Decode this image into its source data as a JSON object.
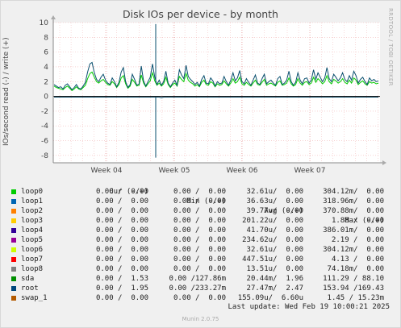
{
  "chart_data": {
    "type": "line",
    "title": "Disk IOs per device - by month",
    "ylabel": "IOs/second read (-) / write (+)",
    "ylim": [
      -9,
      10
    ],
    "yticks": [
      -8,
      -6,
      -4,
      -2,
      0,
      2,
      4,
      6,
      8,
      10
    ],
    "xlabels": [
      "Week 04",
      "Week 05",
      "Week 06",
      "Week 07"
    ],
    "series": [
      {
        "name": "sda",
        "color": "#00cc00",
        "values": [
          1.4,
          1.2,
          1.1,
          1.0,
          0.9,
          1.2,
          1.4,
          1.1,
          0.8,
          1.0,
          1.3,
          1.0,
          0.9,
          1.2,
          1.5,
          2.4,
          3.1,
          3.3,
          2.6,
          2.0,
          1.8,
          2.1,
          2.3,
          1.9,
          1.6,
          1.5,
          2.0,
          1.7,
          1.2,
          1.6,
          2.5,
          2.8,
          1.7,
          1.1,
          1.4,
          2.3,
          1.9,
          1.4,
          1.5,
          2.9,
          1.8,
          1.3,
          1.7,
          2.1,
          3.2,
          2.1,
          1.5,
          1.8,
          1.4,
          1.7,
          2.6,
          1.6,
          1.2,
          1.6,
          1.8,
          1.4,
          2.7,
          2.3,
          2.0,
          3.1,
          2.2,
          1.9,
          1.7,
          1.4,
          1.6,
          1.3,
          1.9,
          2.2,
          1.6,
          1.5,
          2.0,
          1.8,
          1.3,
          1.7,
          1.5,
          1.6,
          2.1,
          1.7,
          1.4,
          1.8,
          2.4,
          1.8,
          2.0,
          2.6,
          1.7,
          1.5,
          1.9,
          1.6,
          1.4,
          1.8,
          2.2,
          1.6,
          1.5,
          1.9,
          2.3,
          1.5,
          1.7,
          1.8,
          1.6,
          1.4,
          1.9,
          2.1,
          1.5,
          1.6,
          1.8,
          2.5,
          1.7,
          1.4,
          1.6,
          2.4,
          1.8,
          1.5,
          1.9,
          2.0,
          1.6,
          1.8,
          2.6,
          1.9,
          2.4,
          2.1,
          1.7,
          2.0,
          2.8,
          2.0,
          1.7,
          2.3,
          2.1,
          1.8,
          2.0,
          2.4,
          1.9,
          1.7,
          2.2,
          1.8,
          2.5,
          2.2,
          1.6,
          1.9,
          2.1,
          1.7,
          1.5,
          2.0,
          1.8,
          1.9,
          1.7,
          1.8
        ]
      },
      {
        "name": "root",
        "color": "#0a4f6e",
        "values": [
          1.6,
          1.4,
          1.2,
          1.3,
          1.0,
          1.5,
          1.7,
          1.3,
          0.9,
          1.2,
          1.6,
          1.1,
          1.0,
          1.4,
          1.9,
          3.3,
          4.4,
          4.6,
          3.2,
          2.3,
          2.0,
          2.6,
          3.0,
          2.2,
          1.8,
          1.6,
          2.5,
          2.0,
          1.3,
          1.9,
          3.3,
          3.9,
          2.0,
          1.2,
          1.6,
          3.0,
          2.3,
          1.5,
          1.7,
          4.1,
          2.1,
          1.4,
          2.0,
          2.6,
          4.4,
          2.6,
          1.6,
          2.2,
          1.5,
          2.0,
          3.4,
          1.8,
          1.3,
          1.8,
          2.2,
          1.5,
          3.6,
          2.9,
          2.4,
          4.2,
          2.7,
          2.3,
          2.0,
          1.6,
          1.9,
          1.4,
          2.3,
          2.8,
          1.8,
          1.7,
          2.5,
          2.1,
          1.4,
          2.0,
          1.7,
          1.8,
          2.7,
          2.0,
          1.5,
          2.2,
          3.2,
          2.1,
          2.5,
          3.5,
          2.0,
          1.7,
          2.4,
          1.9,
          1.5,
          2.2,
          2.9,
          1.8,
          1.6,
          2.4,
          3.0,
          1.7,
          2.0,
          2.2,
          1.8,
          1.5,
          2.4,
          2.7,
          1.6,
          1.8,
          2.2,
          3.4,
          2.0,
          1.5,
          1.9,
          3.2,
          2.2,
          1.7,
          2.4,
          2.5,
          1.8,
          2.2,
          3.6,
          2.3,
          3.2,
          2.6,
          2.0,
          2.5,
          3.9,
          2.4,
          2.0,
          3.0,
          2.6,
          2.1,
          2.5,
          3.2,
          2.3,
          2.0,
          2.8,
          2.2,
          3.4,
          2.8,
          1.8,
          2.3,
          2.6,
          2.0,
          1.6,
          2.5,
          2.1,
          2.3,
          2.0,
          2.1
        ]
      },
      {
        "name": "root read",
        "color": "#0a4f6e",
        "values": [
          -0.1,
          -0.1,
          -0.1,
          -0.1,
          -0.1,
          -0.1,
          -0.1,
          -0.1,
          -0.1,
          -0.1,
          -0.1,
          -0.1,
          -0.1,
          -0.1,
          -0.1,
          -0.1,
          -0.1,
          -0.1,
          -0.1,
          -0.1,
          -0.1,
          -0.1,
          -0.1,
          -0.1,
          -0.1,
          -0.1,
          -0.1,
          -0.1,
          -0.1,
          -0.1,
          -0.1,
          -0.1,
          -0.1,
          -0.1,
          -0.1,
          -0.1,
          -0.1,
          -0.1,
          -0.1,
          -0.1,
          -0.1,
          -0.1,
          -0.1,
          -0.1,
          -0.1,
          -0.1,
          -0.1,
          -0.1,
          -0.2,
          -0.1,
          -0.1,
          -0.1,
          -0.1,
          -0.1,
          -0.1,
          -0.1,
          -0.1,
          -0.1,
          -0.1,
          -0.1,
          -0.1,
          -0.1,
          -0.1,
          -0.1,
          -0.1,
          -0.1,
          -0.1,
          -0.1,
          -0.1,
          -0.1,
          -0.1,
          -0.1,
          -0.1,
          -0.1,
          -0.1,
          -0.1,
          -0.1,
          -0.1,
          -0.1,
          -0.1,
          -0.1,
          -0.1,
          -0.1,
          -0.1,
          -0.1,
          -0.1,
          -0.1,
          -0.1,
          -0.1,
          -0.1,
          -0.1,
          -0.1,
          -0.1,
          -0.1,
          -0.1,
          -0.1,
          -0.1,
          -0.1,
          -0.1,
          -0.1,
          -0.1,
          -0.1,
          -0.1,
          -0.1,
          -0.1,
          -0.1,
          -0.1,
          -0.1,
          -0.1,
          -0.1,
          -0.1,
          -0.1,
          -0.1,
          -0.1,
          -0.1,
          -0.1,
          -0.1,
          -0.1,
          -0.1,
          -0.1,
          -0.1,
          -0.1,
          -0.1,
          -0.1,
          -0.1,
          -0.1,
          -0.1,
          -0.1,
          -0.1,
          -0.1,
          -0.1,
          -0.1,
          -0.1,
          -0.1,
          -0.1,
          -0.1,
          -0.1,
          -0.1,
          -0.1,
          -0.1,
          -0.1,
          -0.1,
          -0.1,
          -0.1,
          -0.1,
          -0.1
        ]
      }
    ],
    "spike": {
      "up": 9.8,
      "down": -8.3
    },
    "grid": true
  },
  "title": "Disk IOs per device - by month",
  "ylabel": "IOs/second read (-) / write (+)",
  "watermark": "RRDTOOL / TOBI OETIKER",
  "legend_header": {
    "cur": "Cur (-/+)",
    "min": "Min (-/+)",
    "avg": "Avg (-/+)",
    "max": "Max (-/+)"
  },
  "legend": [
    {
      "name": "loop0",
      "color": "#00cc00",
      "cur": "0.00 /  0.00",
      "min": "0.00 /  0.00",
      "avg": "32.61u/  0.00",
      "max": "304.12m/  0.00"
    },
    {
      "name": "loop1",
      "color": "#0066b3",
      "cur": "0.00 /  0.00",
      "min": "0.00 /  0.00",
      "avg": "36.63u/  0.00",
      "max": "318.96m/  0.00"
    },
    {
      "name": "loop2",
      "color": "#ff8000",
      "cur": "0.00 /  0.00",
      "min": "0.00 /  0.00",
      "avg": "39.77u/  0.00",
      "max": "370.88m/  0.00"
    },
    {
      "name": "loop3",
      "color": "#ffcc00",
      "cur": "0.00 /  0.00",
      "min": "0.00 /  0.00",
      "avg": "201.22u/  0.00",
      "max": "1.88 /  0.00"
    },
    {
      "name": "loop4",
      "color": "#330099",
      "cur": "0.00 /  0.00",
      "min": "0.00 /  0.00",
      "avg": "41.70u/  0.00",
      "max": "386.01m/  0.00"
    },
    {
      "name": "loop5",
      "color": "#990099",
      "cur": "0.00 /  0.00",
      "min": "0.00 /  0.00",
      "avg": "234.62u/  0.00",
      "max": "2.19 /  0.00"
    },
    {
      "name": "loop6",
      "color": "#ccff00",
      "cur": "0.00 /  0.00",
      "min": "0.00 /  0.00",
      "avg": "32.61u/  0.00",
      "max": "304.12m/  0.00"
    },
    {
      "name": "loop7",
      "color": "#ff0000",
      "cur": "0.00 /  0.00",
      "min": "0.00 /  0.00",
      "avg": "447.51u/  0.00",
      "max": "4.13 /  0.00"
    },
    {
      "name": "loop8",
      "color": "#808080",
      "cur": "0.00 /  0.00",
      "min": "0.00 /  0.00",
      "avg": "13.51u/  0.00",
      "max": "74.18m/  0.00"
    },
    {
      "name": "sda",
      "color": "#008f00",
      "cur": "0.00 /  1.53",
      "min": "0.00 /127.86m",
      "avg": "20.44m/  1.96",
      "max": "111.29 / 88.10"
    },
    {
      "name": "root",
      "color": "#00487d",
      "cur": "0.00 /  1.95",
      "min": "0.00 /233.27m",
      "avg": "27.47m/  2.47",
      "max": "153.94 /169.43"
    },
    {
      "name": "swap_1",
      "color": "#b35a00",
      "cur": "0.00 /  0.00",
      "min": "0.00 /  0.00",
      "avg": "155.09u/  6.60u",
      "max": "1.45 / 15.23m"
    }
  ],
  "footer": "Last update: Wed Feb 19 10:00:21 2025",
  "version": "Munin 2.0.75"
}
